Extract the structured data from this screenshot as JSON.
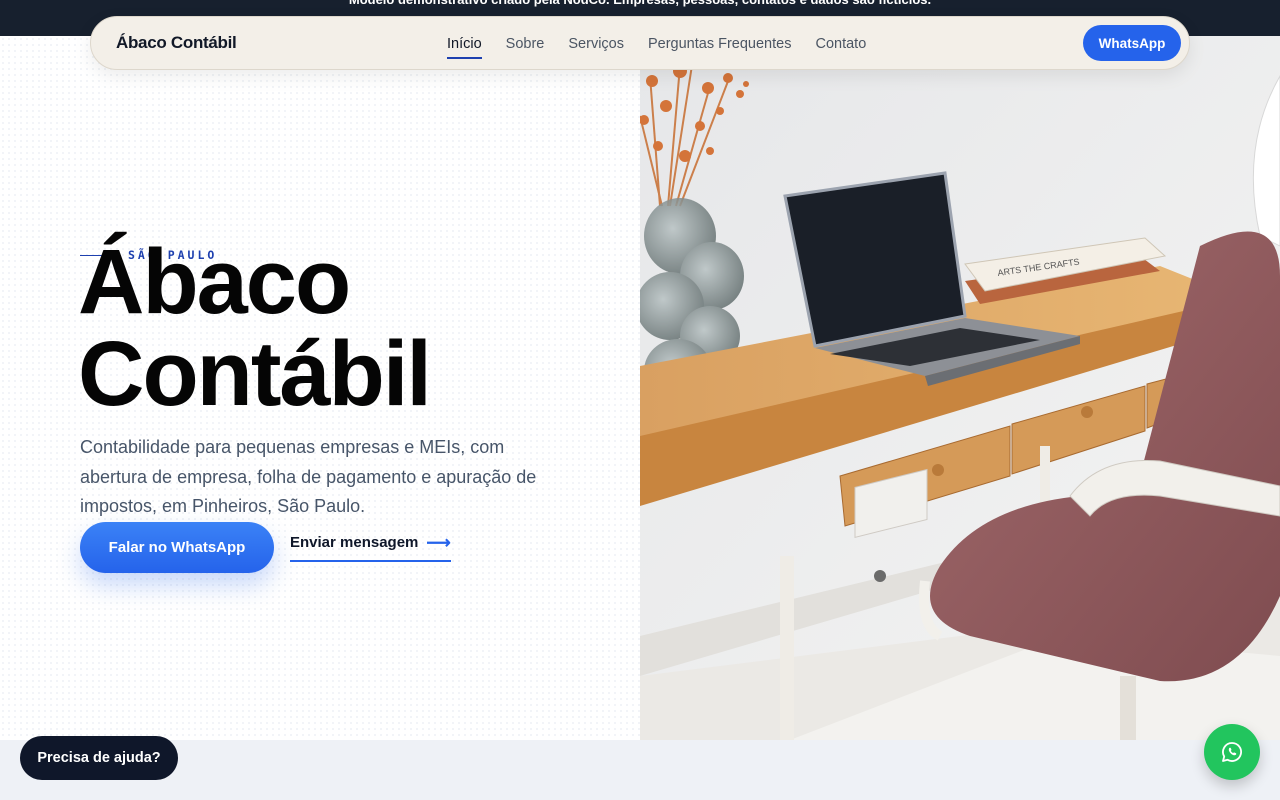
{
  "banner": {
    "text": "Modelo demonstrativo criado pela NodCo. Empresas, pessoas, contatos e dados são fictícios."
  },
  "nav": {
    "brand": "Ábaco Contábil",
    "links": [
      "Início",
      "Sobre",
      "Serviços",
      "Perguntas Frequentes",
      "Contato"
    ],
    "active": "Início",
    "cta": "WhatsApp"
  },
  "hero": {
    "eyebrow": "SÃO PAULO",
    "title_line1": "Ábaco",
    "title_line2": "Contábil",
    "description": "Contabilidade para pequenas empresas e MEIs, com abertura de empresa, folha de pagamento e apuração de impostos, em Pinheiros, São Paulo.",
    "primary_button": "Falar no WhatsApp",
    "secondary_link": "Enviar mensagem",
    "book_title": "ARTS THE CRAFTS"
  },
  "floating": {
    "help": "Precisa de ajuda?",
    "whatsapp_icon": "whatsapp-icon"
  },
  "colors": {
    "accent": "#2563eb",
    "dark": "#0f172a",
    "whatsapp": "#22c55e"
  }
}
